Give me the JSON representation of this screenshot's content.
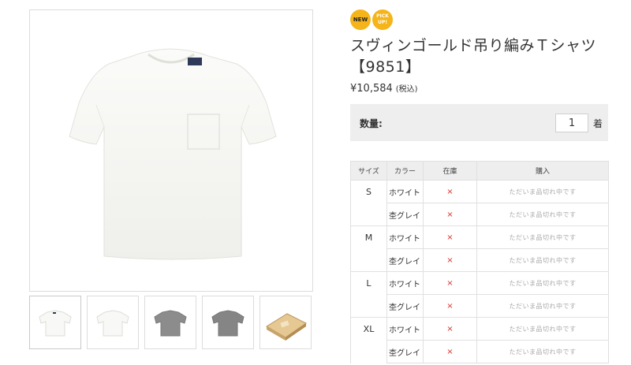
{
  "badges": {
    "new": "NEW",
    "pick": "PICK UP!"
  },
  "product": {
    "title": "スヴィンゴールド吊り編みＴシャツ【9851】",
    "price": "¥10,584",
    "tax": "(税込)"
  },
  "quantity": {
    "label": "数量:",
    "value": "1",
    "unit": "着"
  },
  "table": {
    "headers": {
      "size": "サイズ",
      "color": "カラー",
      "stock": "在庫",
      "buy": "購入"
    },
    "rows": [
      {
        "size": "S",
        "color": "ホワイト",
        "stock": "×",
        "buy": "ただいま品切れ中です"
      },
      {
        "size": "",
        "color": "杢グレイ",
        "stock": "×",
        "buy": "ただいま品切れ中です"
      },
      {
        "size": "M",
        "color": "ホワイト",
        "stock": "×",
        "buy": "ただいま品切れ中です"
      },
      {
        "size": "",
        "color": "杢グレイ",
        "stock": "×",
        "buy": "ただいま品切れ中です"
      },
      {
        "size": "L",
        "color": "ホワイト",
        "stock": "×",
        "buy": "ただいま品切れ中です"
      },
      {
        "size": "",
        "color": "杢グレイ",
        "stock": "×",
        "buy": "ただいま品切れ中です"
      },
      {
        "size": "XL",
        "color": "ホワイト",
        "stock": "×",
        "buy": "ただいま品切れ中です"
      },
      {
        "size": "",
        "color": "杢グレイ",
        "stock": "×",
        "buy": "ただいま品切れ中です"
      }
    ]
  },
  "thumbnails": [
    {
      "icon": "white-tshirt-front-thumbnail"
    },
    {
      "icon": "white-tshirt-back-thumbnail"
    },
    {
      "icon": "gray-tshirt-front-thumbnail"
    },
    {
      "icon": "gray-tshirt-back-thumbnail"
    },
    {
      "icon": "gift-box-thumbnail"
    }
  ],
  "colors": {
    "badge": "#f4b41a",
    "soldout_mark": "#d9302c",
    "panel_bg": "#eeeeee"
  }
}
